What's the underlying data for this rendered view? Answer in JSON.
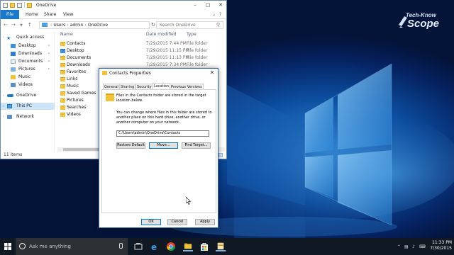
{
  "brand": {
    "line1": "Tech-Know",
    "line2": "Scope"
  },
  "explorer": {
    "title": "OneDrive",
    "ribbon": {
      "tabs": [
        "File",
        "Home",
        "Share",
        "View"
      ]
    },
    "address": {
      "segments": [
        "Users",
        "admin",
        "OneDrive"
      ]
    },
    "search_placeholder": "Search OneDrive",
    "nav_pane": {
      "items": [
        {
          "label": "Quick access",
          "icon": "star-icon",
          "pinned": false,
          "selected": false
        },
        {
          "label": "Desktop",
          "icon": "desktop-folder-icon",
          "pinned": true,
          "selected": false
        },
        {
          "label": "Downloads",
          "icon": "downloads-folder-icon",
          "pinned": true,
          "selected": false
        },
        {
          "label": "Documents",
          "icon": "documents-folder-icon",
          "pinned": true,
          "selected": false
        },
        {
          "label": "Pictures",
          "icon": "pictures-folder-icon",
          "pinned": true,
          "selected": false
        },
        {
          "label": "Music",
          "icon": "music-folder-icon",
          "pinned": false,
          "selected": false
        },
        {
          "label": "Videos",
          "icon": "videos-folder-icon",
          "pinned": false,
          "selected": false
        },
        {
          "label": "OneDrive",
          "icon": "cloud-icon",
          "pinned": false,
          "selected": false
        },
        {
          "label": "This PC",
          "icon": "computer-icon",
          "pinned": false,
          "selected": true
        },
        {
          "label": "Network",
          "icon": "network-icon",
          "pinned": false,
          "selected": false
        }
      ]
    },
    "columns": {
      "name": "Name",
      "date_modified": "Date modified",
      "type": "Type"
    },
    "files": [
      {
        "name": "Contacts",
        "date": "7/29/2015 7:44 PM",
        "type": "File folder"
      },
      {
        "name": "Desktop",
        "date": "7/29/2015 11:15 PM",
        "type": "File folder"
      },
      {
        "name": "Documents",
        "date": "7/29/2015 11:13 PM",
        "type": "File folder"
      },
      {
        "name": "Downloads",
        "date": "7/29/2015 7:34 PM",
        "type": "File folder"
      },
      {
        "name": "Favorites"
      },
      {
        "name": "Links"
      },
      {
        "name": "Music"
      },
      {
        "name": "Saved Games"
      },
      {
        "name": "Pictures"
      },
      {
        "name": "Searches"
      },
      {
        "name": "Videos"
      }
    ],
    "status": "11 items"
  },
  "dialog": {
    "title": "Contacts Properties",
    "tabs": [
      "General",
      "Sharing",
      "Security",
      "Location",
      "Previous Versions"
    ],
    "active_tab": "Location",
    "info_text": "Files in the Contacts folder are stored in the target location below.",
    "move_text": "You can change where files in this folder are stored to another place on this hard drive, another drive, or another computer on your network.",
    "path_value": "C:\\Users\\admin\\OneDrive\\Contacts",
    "buttons": {
      "restore_default": "Restore Default",
      "move": "Move...",
      "find_target": "Find Target...",
      "ok": "OK",
      "cancel": "Cancel",
      "apply": "Apply"
    }
  },
  "taskbar": {
    "search_placeholder": "Ask me anything",
    "apps": [
      "task-view-icon",
      "edge-icon",
      "chrome-icon",
      "file-explorer-icon",
      "store-icon",
      "folder-icon"
    ],
    "clock_time": "11:33 PM",
    "clock_date": "7/30/2015"
  },
  "colors": {
    "accent": "#1979ca",
    "wallpaper_glow": "#2f86d4",
    "wallpaper_dark": "#041338",
    "taskbar": "#101823",
    "folder": "#f0c33c"
  }
}
